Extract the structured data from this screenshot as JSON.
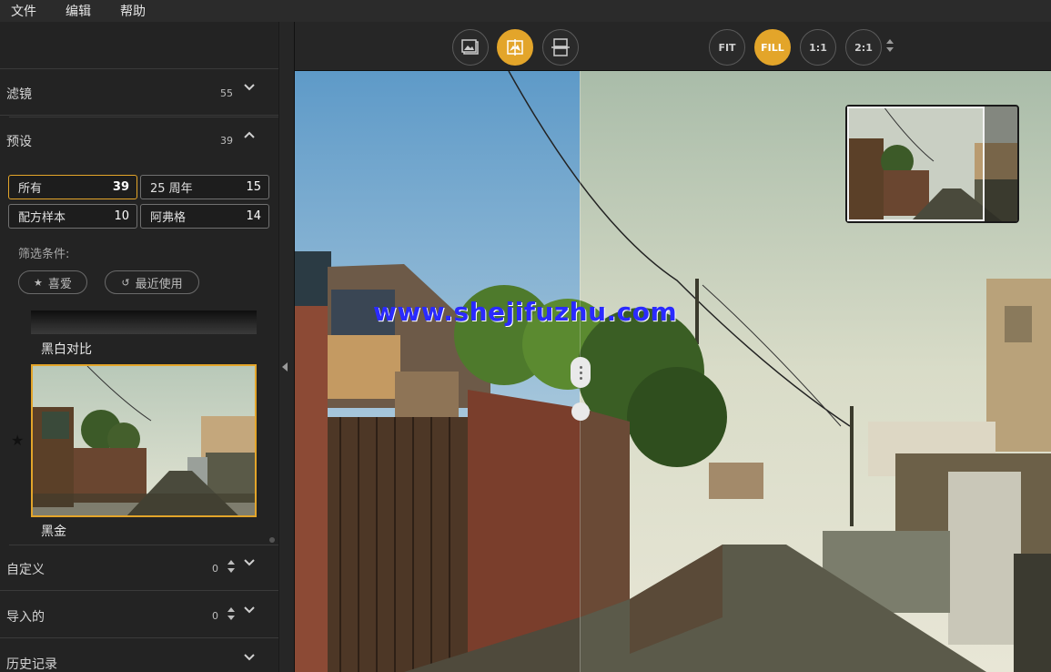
{
  "menu": [
    "文件",
    "编辑",
    "帮助"
  ],
  "sidebar": {
    "filters": {
      "title": "滤镜",
      "count": "55"
    },
    "presets": {
      "title": "预设",
      "count": "39"
    },
    "chips": [
      {
        "label": "所有",
        "count": "39"
      },
      {
        "label": "25 周年",
        "count": "15"
      },
      {
        "label": "配方样本",
        "count": "10"
      },
      {
        "label": "阿弗格",
        "count": "14"
      }
    ],
    "filter_label": "筛选条件:",
    "favorites": "喜爱",
    "recent": "最近使用",
    "preset_items": [
      {
        "label": "黑白对比"
      },
      {
        "label": "黑金"
      }
    ],
    "custom": {
      "title": "自定义",
      "count": "0"
    },
    "imported": {
      "title": "导入的",
      "count": "0"
    },
    "history": {
      "title": "历史记录"
    }
  },
  "toolbar": {
    "view_buttons": [
      "image-view",
      "split-view",
      "side-by-side-view"
    ],
    "zoom_buttons": [
      "FIT",
      "FILL",
      "1:1",
      "2:1"
    ],
    "active_zoom": "FILL"
  },
  "watermark": "www.shejifuzhu.com",
  "colors": {
    "accent": "#e3a52a",
    "panel": "#232323",
    "toolbar": "#262626"
  }
}
